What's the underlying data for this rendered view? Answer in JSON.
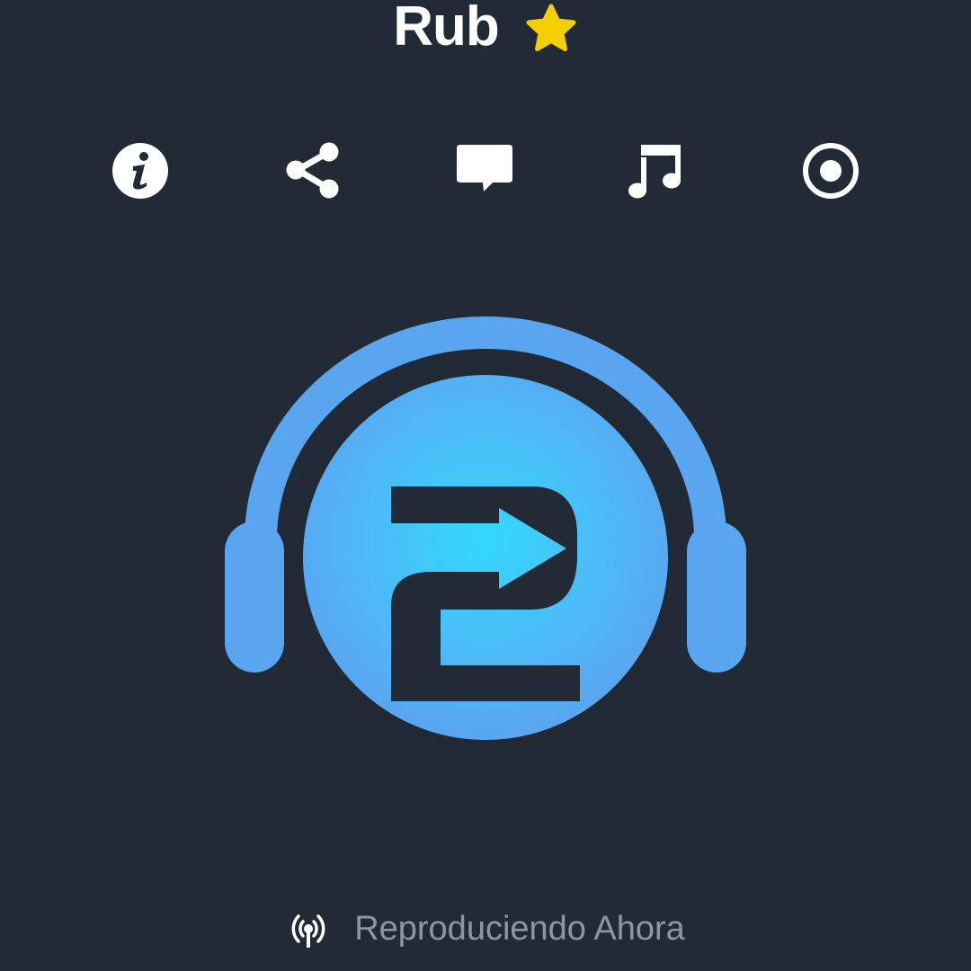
{
  "station": {
    "title": "Rub",
    "favorite_icon": "star-icon",
    "favorite_color": "#f5d000"
  },
  "toolbar": {
    "items": [
      {
        "name": "info",
        "icon": "info-icon"
      },
      {
        "name": "share",
        "icon": "share-icon"
      },
      {
        "name": "comments",
        "icon": "chat-bubble-icon"
      },
      {
        "name": "songs",
        "icon": "music-note-icon"
      },
      {
        "name": "record",
        "icon": "record-icon"
      }
    ]
  },
  "logo": {
    "icon": "headphones-logo",
    "accent_color": "#5aa5f0"
  },
  "status": {
    "icon": "broadcast-icon",
    "label": "Reproduciendo Ahora",
    "label_color": "#8f96a2"
  },
  "colors": {
    "background": "#222a36",
    "icon": "#ffffff"
  }
}
